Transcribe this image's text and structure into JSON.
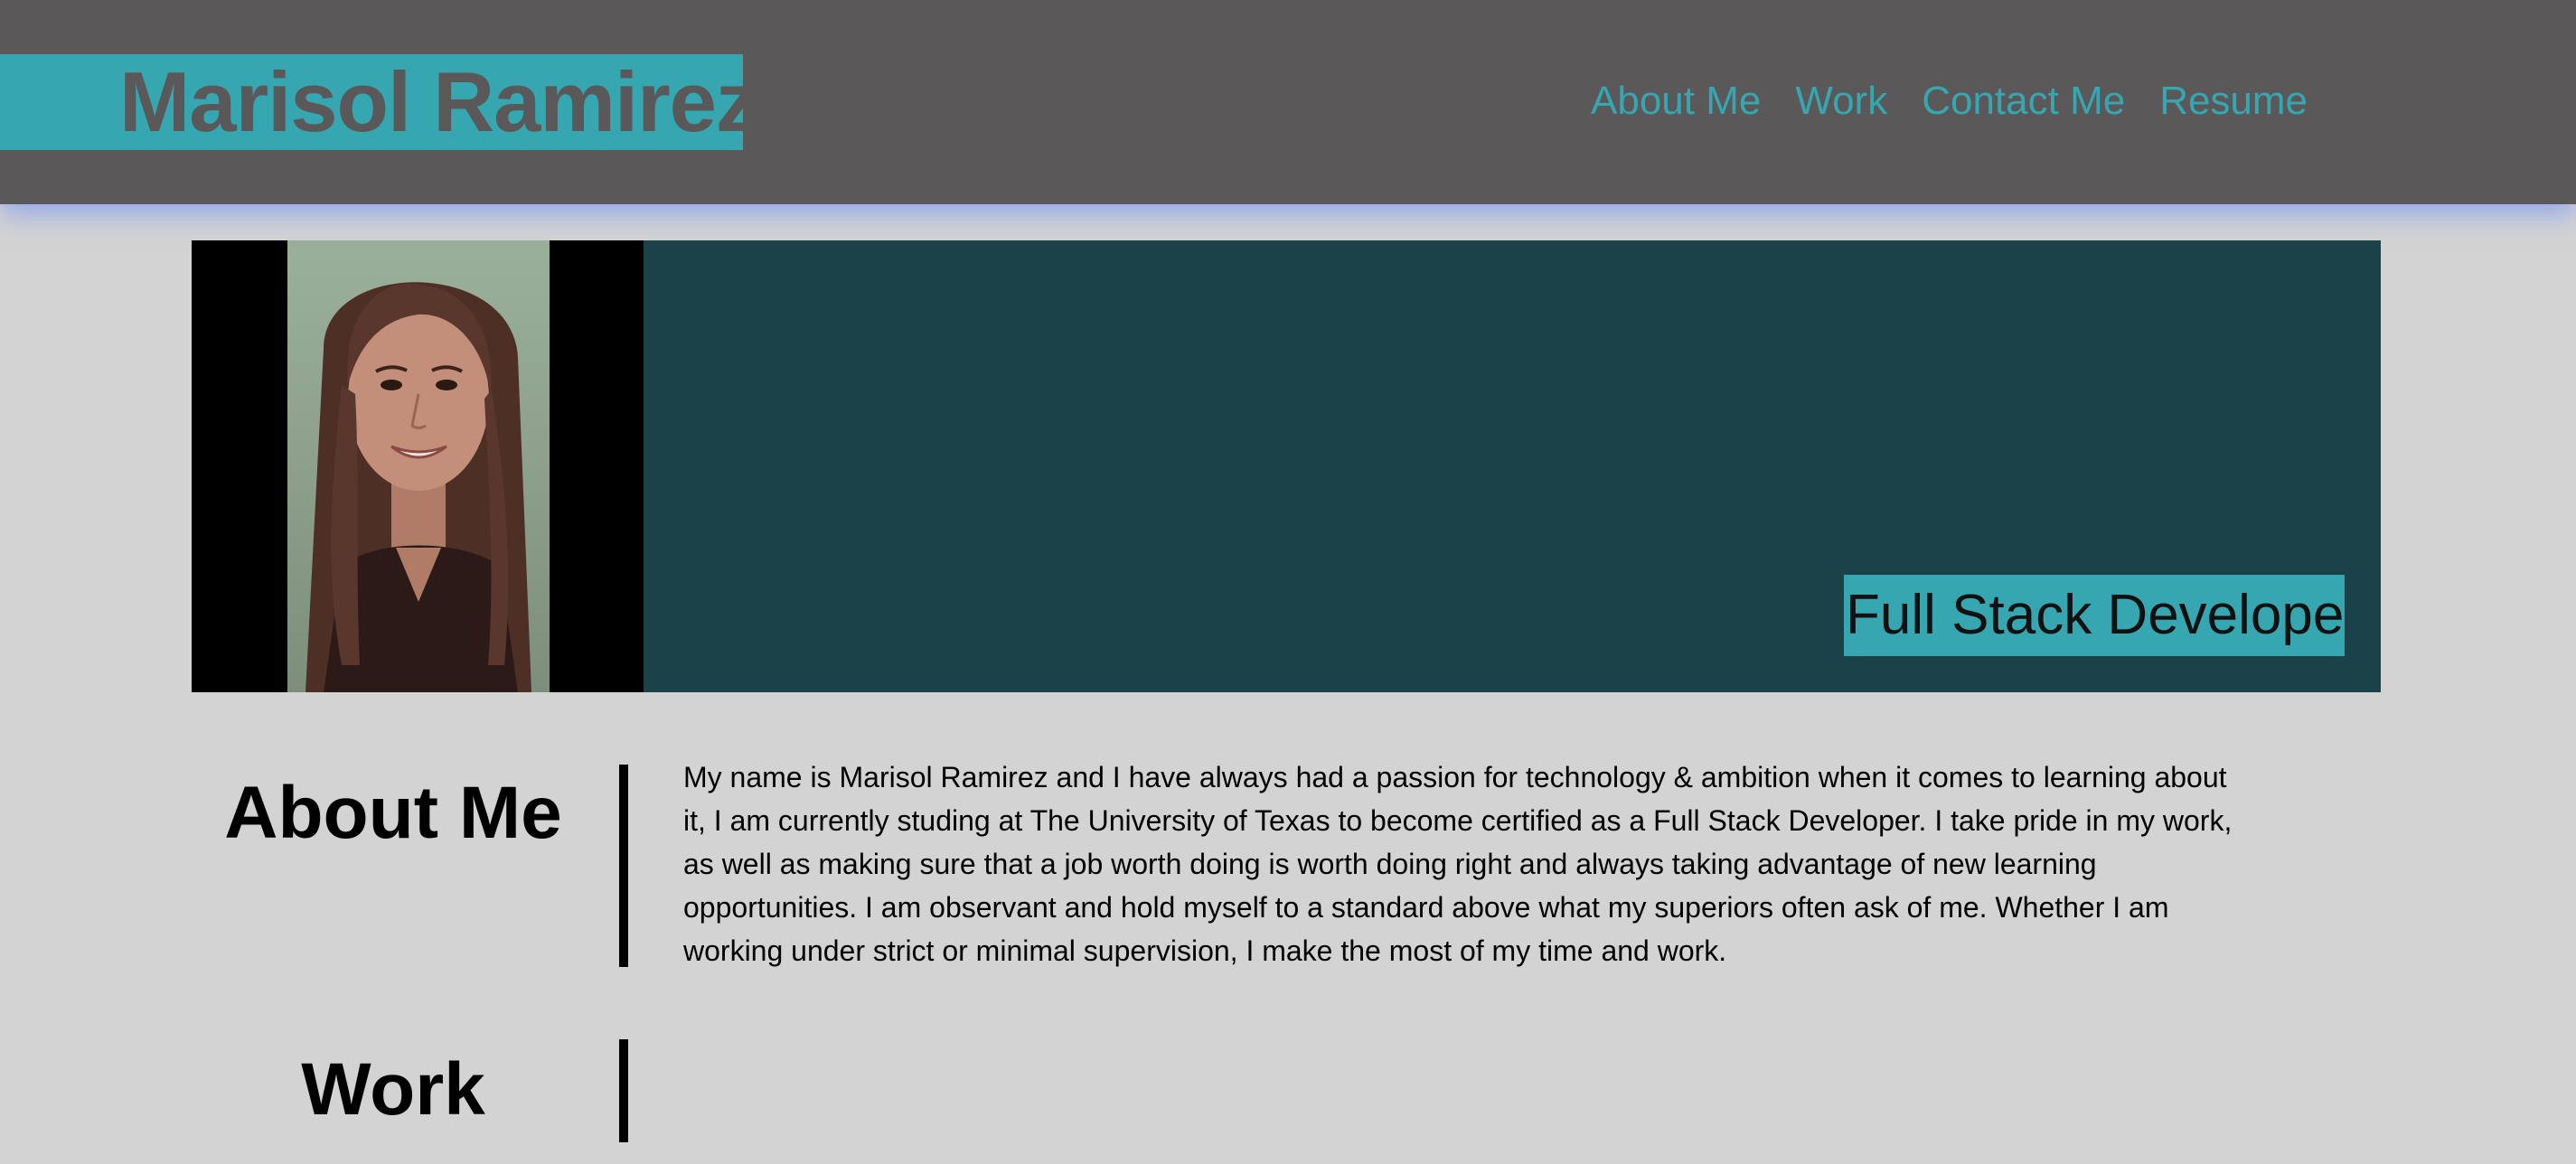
{
  "header": {
    "name": "Marisol Ramirez",
    "nav": [
      "About Me",
      "Work",
      "Contact Me",
      "Resume"
    ]
  },
  "hero": {
    "role": "Full Stack Developer"
  },
  "about": {
    "title": "About Me",
    "text": "My name is Marisol Ramirez and I have always had a passion for technology & ambition when it comes to learning about it, I am currently studing at The University of Texas to become certified as a Full Stack Developer. I take pride in my work, as well as making sure that a job worth doing is worth doing right and always taking advantage of new learning opportunities. I am observant and hold myself to a standard above what my superiors often ask of me. Whether I am working under strict or minimal supervision, I make the most of my time and work."
  },
  "work": {
    "title": "Work"
  },
  "colors": {
    "accent": "#36a6b0",
    "header_bg": "#5a5859",
    "hero_bg": "#1c4249",
    "page_bg": "#d3d3d3"
  }
}
